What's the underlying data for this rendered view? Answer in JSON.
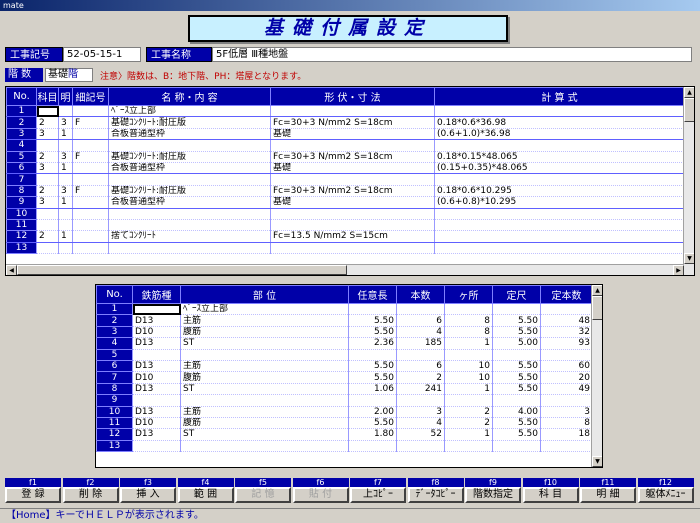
{
  "window": {
    "title": "mate"
  },
  "screen_title": "基礎付属設定",
  "header": {
    "project_no_label": "工事記号",
    "project_no": "52-05-15-1",
    "project_name_label": "工事名称",
    "project_name": "5F低層 Ⅲ種地盤"
  },
  "floor": {
    "label": "階 数",
    "value_prefix": "基礎",
    "value_suffix": "階",
    "notice": "注意〉階数は、B：地下階、PH：塔屋となります。"
  },
  "grid1": {
    "headers": [
      "No.",
      "科目",
      "明",
      "細記号",
      "名 称・内 容",
      "形 伏・寸 法",
      "計 算 式"
    ],
    "rows": [
      {
        "no": "1",
        "k": "",
        "m": "",
        "s": "",
        "name": "ﾍﾞｰｽ立上部",
        "dim": "",
        "calc": ""
      },
      {
        "no": "2",
        "k": "2",
        "m": "3",
        "s": "F",
        "name": "基礎ｺﾝｸﾘｰﾄ:耐圧版",
        "dim": "Fc=30+3 N/mm2 S=18cm",
        "calc": "0.18*0.6*36.98"
      },
      {
        "no": "3",
        "k": "3",
        "m": "1",
        "s": "",
        "name": "合板普通型枠",
        "dim": "基礎",
        "calc": "(0.6+1.0)*36.98"
      },
      {
        "no": "4",
        "k": "",
        "m": "",
        "s": "",
        "name": "",
        "dim": "",
        "calc": ""
      },
      {
        "no": "5",
        "k": "2",
        "m": "3",
        "s": "F",
        "name": "基礎ｺﾝｸﾘｰﾄ:耐圧版",
        "dim": "Fc=30+3 N/mm2 S=18cm",
        "calc": "0.18*0.15*48.065"
      },
      {
        "no": "6",
        "k": "3",
        "m": "1",
        "s": "",
        "name": "合板普通型枠",
        "dim": "基礎",
        "calc": "(0.15+0.35)*48.065"
      },
      {
        "no": "7",
        "k": "",
        "m": "",
        "s": "",
        "name": "",
        "dim": "",
        "calc": ""
      },
      {
        "no": "8",
        "k": "2",
        "m": "3",
        "s": "F",
        "name": "基礎ｺﾝｸﾘｰﾄ:耐圧版",
        "dim": "Fc=30+3 N/mm2 S=18cm",
        "calc": "0.18*0.6*10.295"
      },
      {
        "no": "9",
        "k": "3",
        "m": "1",
        "s": "",
        "name": "合板普通型枠",
        "dim": "基礎",
        "calc": "(0.6+0.8)*10.295"
      },
      {
        "no": "10",
        "k": "",
        "m": "",
        "s": "",
        "name": "",
        "dim": "",
        "calc": ""
      },
      {
        "no": "11",
        "k": "",
        "m": "",
        "s": "",
        "name": "",
        "dim": "",
        "calc": ""
      },
      {
        "no": "12",
        "k": "2",
        "m": "1",
        "s": "",
        "name": "捨てｺﾝｸﾘｰﾄ",
        "dim": "Fc=13.5 N/mm2 S=15cm",
        "calc": ""
      },
      {
        "no": "13",
        "k": "",
        "m": "",
        "s": "",
        "name": "",
        "dim": "",
        "calc": ""
      }
    ]
  },
  "grid2": {
    "headers": [
      "No.",
      "鉄筋種",
      "部 位",
      "任意長",
      "本数",
      "ヶ所",
      "定尺",
      "定本数"
    ],
    "rows": [
      {
        "no": "1",
        "type": "",
        "part": "ﾍﾞｰｽ立上部",
        "len": "",
        "cnt": "",
        "loc": "",
        "std": "",
        "stdn": ""
      },
      {
        "no": "2",
        "type": "D13",
        "part": "主筋",
        "len": "5.50",
        "cnt": "6",
        "loc": "8",
        "std": "5.50",
        "stdn": "48"
      },
      {
        "no": "3",
        "type": "D10",
        "part": "腹筋",
        "len": "5.50",
        "cnt": "4",
        "loc": "8",
        "std": "5.50",
        "stdn": "32"
      },
      {
        "no": "4",
        "type": "D13",
        "part": "ST",
        "len": "2.36",
        "cnt": "185",
        "loc": "1",
        "std": "5.00",
        "stdn": "93"
      },
      {
        "no": "5",
        "type": "",
        "part": "",
        "len": "",
        "cnt": "",
        "loc": "",
        "std": "",
        "stdn": ""
      },
      {
        "no": "6",
        "type": "D13",
        "part": "主筋",
        "len": "5.50",
        "cnt": "6",
        "loc": "10",
        "std": "5.50",
        "stdn": "60"
      },
      {
        "no": "7",
        "type": "D10",
        "part": "腹筋",
        "len": "5.50",
        "cnt": "2",
        "loc": "10",
        "std": "5.50",
        "stdn": "20"
      },
      {
        "no": "8",
        "type": "D13",
        "part": "ST",
        "len": "1.06",
        "cnt": "241",
        "loc": "1",
        "std": "5.50",
        "stdn": "49"
      },
      {
        "no": "9",
        "type": "",
        "part": "",
        "len": "",
        "cnt": "",
        "loc": "",
        "std": "",
        "stdn": ""
      },
      {
        "no": "10",
        "type": "D13",
        "part": "主筋",
        "len": "2.00",
        "cnt": "3",
        "loc": "2",
        "std": "4.00",
        "stdn": "3"
      },
      {
        "no": "11",
        "type": "D10",
        "part": "腹筋",
        "len": "5.50",
        "cnt": "4",
        "loc": "2",
        "std": "5.50",
        "stdn": "8"
      },
      {
        "no": "12",
        "type": "D13",
        "part": "ST",
        "len": "1.80",
        "cnt": "52",
        "loc": "1",
        "std": "5.50",
        "stdn": "18"
      },
      {
        "no": "13",
        "type": "",
        "part": "",
        "len": "",
        "cnt": "",
        "loc": "",
        "std": "",
        "stdn": ""
      }
    ]
  },
  "fkeys": [
    {
      "fn": "f1",
      "label": "登 録",
      "enabled": true
    },
    {
      "fn": "f2",
      "label": "削 除",
      "enabled": true
    },
    {
      "fn": "f3",
      "label": "挿 入",
      "enabled": true
    },
    {
      "fn": "f4",
      "label": "範 囲",
      "enabled": true
    },
    {
      "fn": "f5",
      "label": "記 憶",
      "enabled": false
    },
    {
      "fn": "f6",
      "label": "貼 付",
      "enabled": false
    },
    {
      "fn": "f7",
      "label": "上ｺﾋﾟｰ",
      "enabled": true
    },
    {
      "fn": "f8",
      "label": "ﾃﾞｰﾀｺﾋﾟｰ",
      "enabled": true
    },
    {
      "fn": "f9",
      "label": "階数指定",
      "enabled": true
    },
    {
      "fn": "f10",
      "label": "科 目",
      "enabled": true
    },
    {
      "fn": "f11",
      "label": "明 細",
      "enabled": true
    },
    {
      "fn": "f12",
      "label": "躯体ﾒﾆｭｰ",
      "enabled": true
    }
  ],
  "status": "【Home】キーでＨＥＬＰが表示されます。"
}
